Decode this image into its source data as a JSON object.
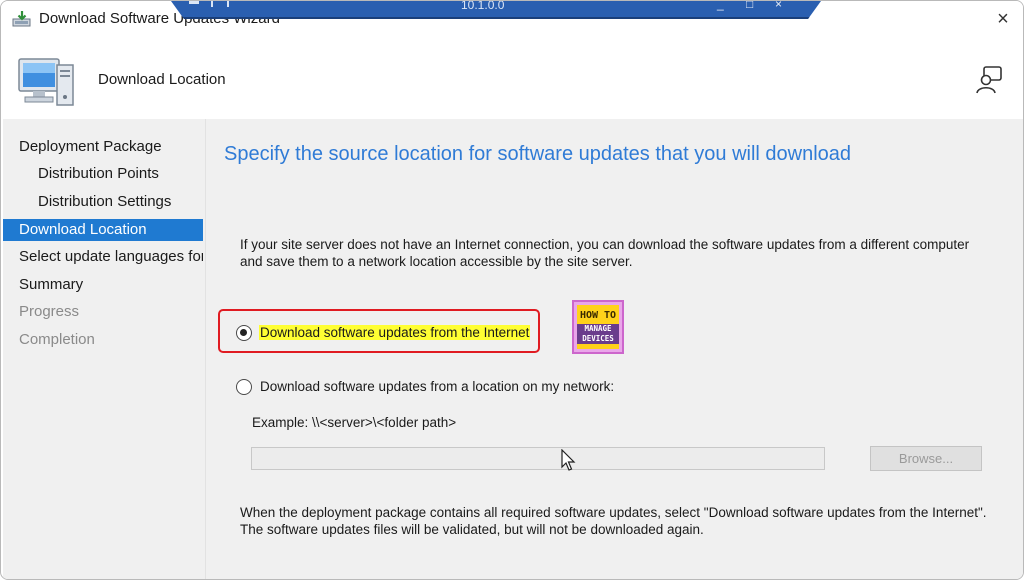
{
  "window": {
    "title": "Download Software Updates Wizard",
    "remote_host": "10.1.0.0",
    "remote_controls": [
      "_",
      "□",
      "×"
    ],
    "close_glyph": "×"
  },
  "header": {
    "title": "Download Location"
  },
  "sidebar": {
    "items": [
      {
        "label": "Deployment Package",
        "level": 0,
        "state": "normal"
      },
      {
        "label": "Distribution Points",
        "level": 1,
        "state": "normal"
      },
      {
        "label": "Distribution Settings",
        "level": 1,
        "state": "normal"
      },
      {
        "label": "Download Location",
        "level": 0,
        "state": "active"
      },
      {
        "label": "Select update languages for",
        "level": 0,
        "state": "normal"
      },
      {
        "label": "Summary",
        "level": 0,
        "state": "normal"
      },
      {
        "label": "Progress",
        "level": 0,
        "state": "disabled"
      },
      {
        "label": "Completion",
        "level": 0,
        "state": "disabled"
      }
    ]
  },
  "main": {
    "title": "Specify the source location for software updates that you will download",
    "intro_line1": "If your site server does not have an Internet connection, you can download the software updates from a different computer",
    "intro_line2": "and save them to a network location accessible by the site server.",
    "option_internet": {
      "label": "Download software updates from the Internet",
      "selected": true
    },
    "option_network": {
      "label": "Download software updates from a location on my network:",
      "selected": false
    },
    "example_text": "Example: \\\\<server>\\<folder path>",
    "path_value": "",
    "browse_label": "Browse...",
    "footer_line1": "When the deployment package contains all required software updates, select \"Download  software updates from the Internet\".",
    "footer_line2": "The software updates files will be validated, but will not be downloaded again."
  },
  "logo": {
    "line1": "HOW TO",
    "line2": "MANAGE",
    "line3": "DEVICES"
  },
  "colors": {
    "accent": "#1f7ad1",
    "title_blue": "#2f7bd6",
    "highlight_yellow": "#ffff33",
    "callout_red": "#e01b22"
  }
}
